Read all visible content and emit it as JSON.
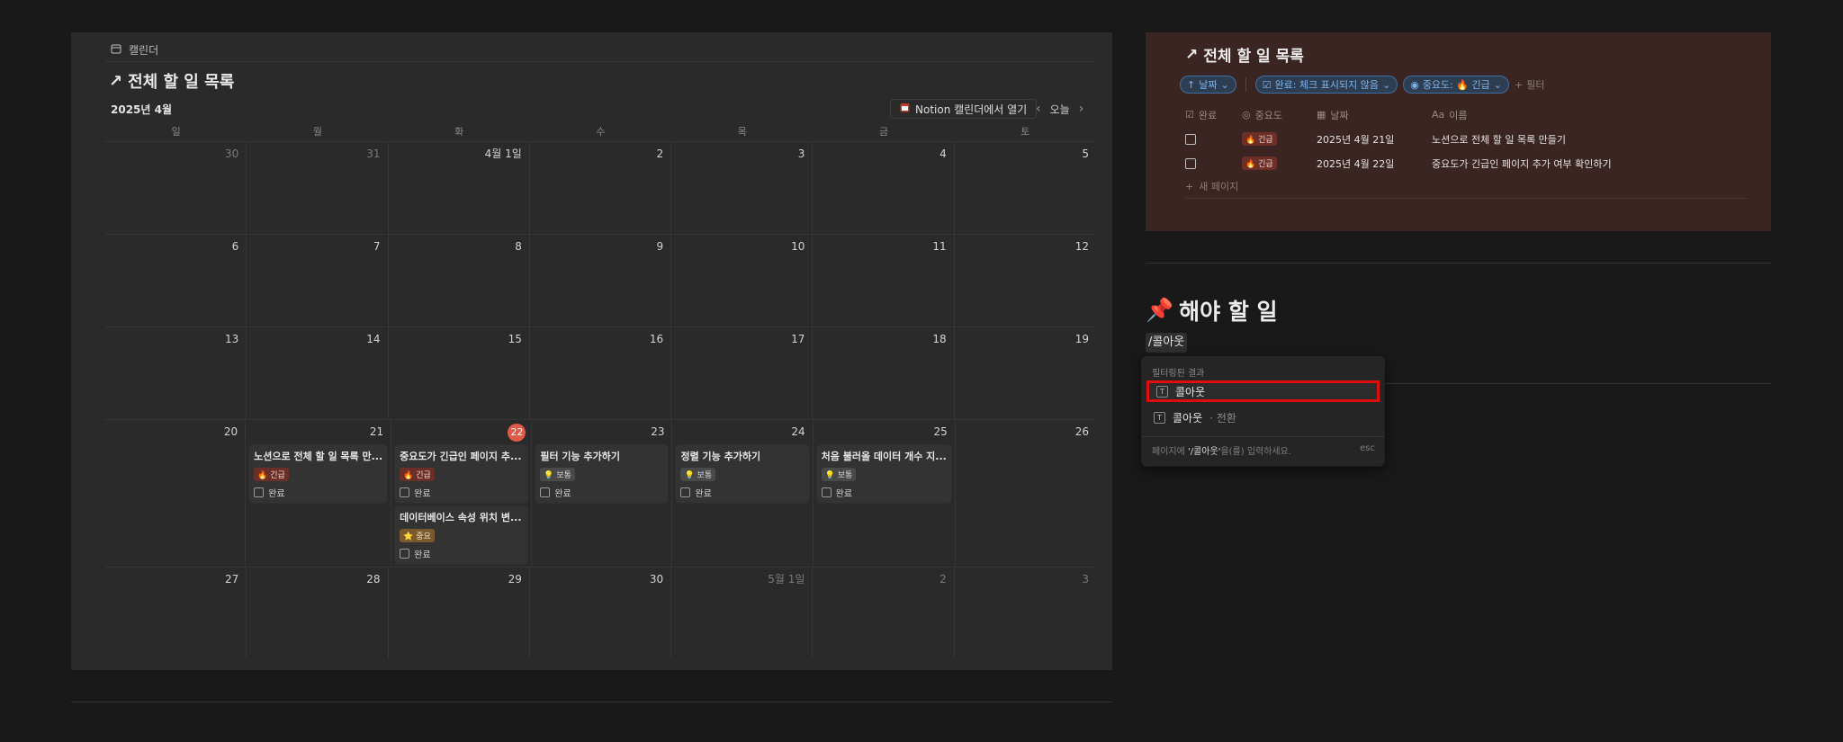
{
  "calendar": {
    "tab_label": "캘린더",
    "title": "전체 할 일 목록",
    "month": "2025년 4월",
    "open_button": "Notion 캘린더에서 열기",
    "today_button": "오늘",
    "weekdays": [
      "일",
      "월",
      "화",
      "수",
      "목",
      "금",
      "토"
    ],
    "weeks": [
      [
        "30",
        "31",
        "4월 1일",
        "2",
        "3",
        "4",
        "5"
      ],
      [
        "6",
        "7",
        "8",
        "9",
        "10",
        "11",
        "12"
      ],
      [
        "13",
        "14",
        "15",
        "16",
        "17",
        "18",
        "19"
      ],
      [
        "20",
        "21",
        "22",
        "23",
        "24",
        "25",
        "26"
      ],
      [
        "27",
        "28",
        "29",
        "30",
        "5월 1일",
        "2",
        "3"
      ]
    ],
    "events": {
      "e21": {
        "title": "노션으로 전체 할 일 목록 만...",
        "tag": "🔥 긴급",
        "done": "완료"
      },
      "e22a": {
        "title": "중요도가 긴급인 페이지 추...",
        "tag": "🔥 긴급",
        "done": "완료"
      },
      "e22b": {
        "title": "데이터베이스 속성 위치 변...",
        "tag": "⭐ 중요",
        "done": "완료"
      },
      "e23": {
        "title": "필터 기능 추가하기",
        "tag": "💡 보통",
        "done": "완료"
      },
      "e24": {
        "title": "정렬 기능 추가하기",
        "tag": "💡 보통",
        "done": "완료"
      },
      "e25": {
        "title": "처음 불러올 데이터 개수 지...",
        "tag": "💡 보통",
        "done": "완료"
      }
    }
  },
  "table": {
    "title": "전체 할 일 목록",
    "filters": {
      "sort": "날짜",
      "done": "완료: 체크 표시되지 않음",
      "priority": "중요도: 🔥 긴급",
      "add": "필터"
    },
    "columns": {
      "done": "완료",
      "priority": "중요도",
      "date": "날짜",
      "name": "이름"
    },
    "rows": [
      {
        "priority": "🔥 긴급",
        "date": "2025년 4월 21일",
        "name": "노션으로 전체 할 일 목록 만들기"
      },
      {
        "priority": "🔥 긴급",
        "date": "2025년 4월 22일",
        "name": "중요도가 긴급인 페이지 추가 여부 확인하기"
      }
    ],
    "new_page": "새 페이지"
  },
  "todo": {
    "heading": "해야 할 일",
    "heading_emoji": "📌",
    "slash_text": "/콜아웃"
  },
  "menu": {
    "label": "필터링된 결과",
    "items": [
      {
        "label": "콜아웃",
        "sub": ""
      },
      {
        "label": "콜아웃",
        "sub": "전환"
      }
    ],
    "footer_prefix": "페이지에 ",
    "footer_cmd": "'/콜아웃'",
    "footer_suffix": "을(를) 입력하세요.",
    "footer_esc": "esc"
  }
}
